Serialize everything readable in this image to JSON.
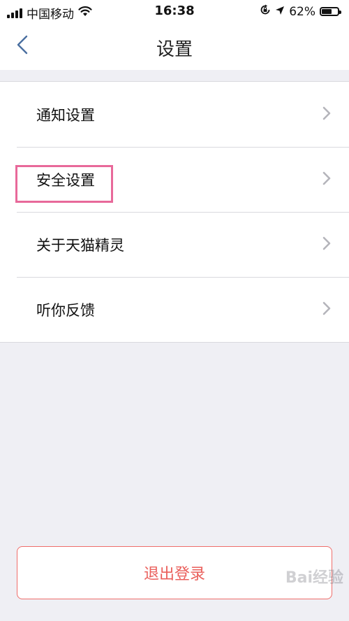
{
  "status_bar": {
    "carrier": "中国移动",
    "time": "16:38",
    "battery_percent": "62%",
    "battery_level": 0.62,
    "icons": [
      "signal-icon",
      "wifi-icon",
      "orientation-lock-icon",
      "location-arrow-icon",
      "battery-icon"
    ]
  },
  "nav": {
    "title": "设置",
    "back_icon": "chevron-left-icon"
  },
  "menu": {
    "items": [
      {
        "label": "通知设置",
        "icon": "chevron-right-icon"
      },
      {
        "label": "安全设置",
        "icon": "chevron-right-icon",
        "highlighted": true
      },
      {
        "label": "关于天猫精灵",
        "icon": "chevron-right-icon"
      },
      {
        "label": "听你反馈",
        "icon": "chevron-right-icon"
      }
    ]
  },
  "logout": {
    "label": "退出登录"
  },
  "watermark": {
    "text": "Bai经验"
  },
  "colors": {
    "background": "#efeff4",
    "accent_red": "#ea5f5b",
    "highlight_pink": "#e8699a"
  }
}
